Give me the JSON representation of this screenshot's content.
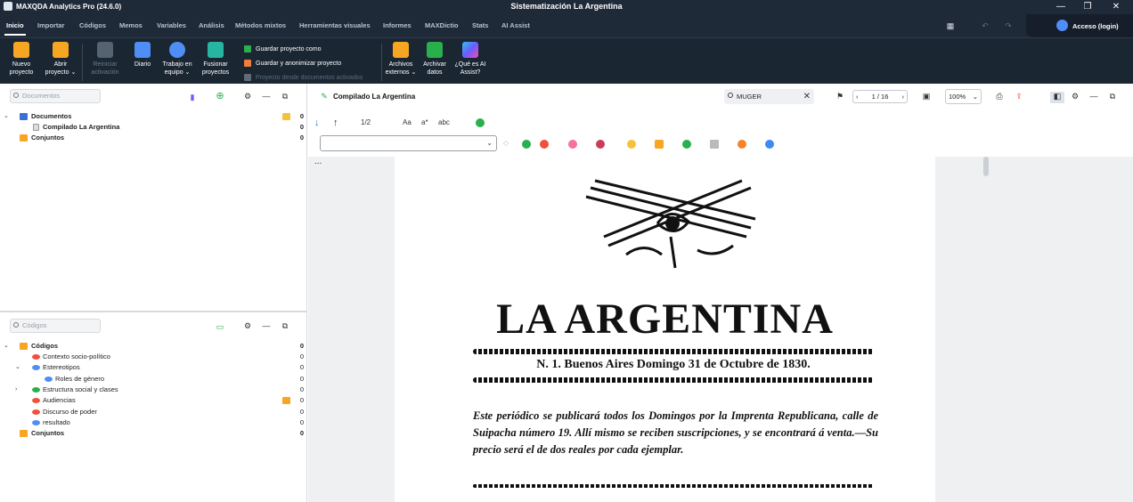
{
  "titlebar": {
    "app_name": "MAXQDA Analytics Pro (24.6.0)",
    "window_title": "Sistematización La Argentina",
    "minimize": "—",
    "restore": "❐",
    "close": "✕"
  },
  "menu": {
    "tabs": [
      "Inicio",
      "Importar",
      "Códigos",
      "Memos",
      "Variables",
      "Análisis",
      "Métodos mixtos",
      "Herramientas visuales",
      "Informes",
      "MAXDictio",
      "Stats",
      "AI Assist"
    ],
    "login": "Acceso (login)"
  },
  "ribbon": {
    "nuevo": [
      "Nuevo",
      "proyecto"
    ],
    "abrir": [
      "Abrir",
      "proyecto ⌄"
    ],
    "reiniciar": [
      "Reiniciar",
      "activación"
    ],
    "diario": "Diario",
    "trabajo": [
      "Trabajo en",
      "equipo ⌄"
    ],
    "fusionar": [
      "Fusionar",
      "proyectos"
    ],
    "guardar_como": "Guardar proyecto como",
    "guardar_anon": "Guardar y anonimizar proyecto",
    "proyecto_desde": "Proyecto desde documentos activados",
    "archivos": [
      "Archivos",
      "externos ⌄"
    ],
    "archivar": [
      "Archivar",
      "datos"
    ],
    "ai": [
      "¿Qué es AI",
      "Assist?"
    ]
  },
  "documents_panel": {
    "search_placeholder": "Documentos",
    "root_label": "Documentos",
    "root_count": "0",
    "doc_label": "Compilado La Argentina",
    "doc_count": "0",
    "sets_label": "Conjuntos",
    "sets_count": "0"
  },
  "codes_panel": {
    "search_placeholder": "Códigos",
    "root_label": "Códigos",
    "root_count": "0",
    "items": [
      {
        "label": "Contexto socio-político",
        "count": "0",
        "color": "#f0503c"
      },
      {
        "label": "Estereotipos",
        "count": "0",
        "color": "#4f8ef5"
      },
      {
        "label": "Roles de género",
        "count": "0",
        "color": "#4f8ef5"
      },
      {
        "label": "Estructura social y clases",
        "count": "0",
        "color": "#29b04c"
      },
      {
        "label": "Audiencias",
        "count": "0",
        "color": "#f0503c"
      },
      {
        "label": "Discurso de poder",
        "count": "0",
        "color": "#f0503c"
      },
      {
        "label": "resultado",
        "count": "0",
        "color": "#4f8ef5"
      }
    ],
    "sets_label": "Conjuntos",
    "sets_count": "0"
  },
  "viewer": {
    "doc_title": "Compilado La Argentina",
    "search_value": "MUGER",
    "page": "1 / 16",
    "zoom": "100%",
    "nav_counter": "1/2",
    "more": "...",
    "font_a": "Aa",
    "font_b": "a*",
    "font_c": "abc"
  },
  "page_content": {
    "title": "LA ARGENTINA",
    "dateline": "N. 1.  Buenos Aires Domingo 31 de Octubre de 1830.",
    "paragraph": "Este periódico se publicará todos los Domingos por la Imprenta Republicana, calle de Suipacha número 19. Allí mismo se reciben suscripciones, y se encontrará á venta.—Su precio será el de dos reales por cada ejemplar."
  }
}
